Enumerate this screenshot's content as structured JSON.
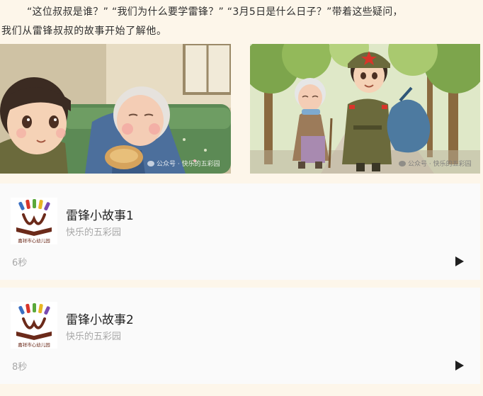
{
  "intro": {
    "line1": "“这位叔叔是谁？” “我们为什么要学雷锋？” “3月5日是什么日子？”带着这些疑问，",
    "line2": "我们从雷锋叔叔的故事开始了解他。"
  },
  "illustrations": {
    "left_watermark": "公众号 · 快乐的五彩园",
    "right_watermark": "公众号 · 快乐的五彩园"
  },
  "videos": [
    {
      "title": "雷锋小故事1",
      "channel": "快乐的五彩园",
      "duration": "6秒",
      "logo_caption": "嘉祥市心幼儿园",
      "logo_icon": "rainbow-kindergarten-logo",
      "play_icon": "play-triangle"
    },
    {
      "title": "雷锋小故事2",
      "channel": "快乐的五彩园",
      "duration": "8秒",
      "logo_caption": "嘉祥市心幼儿园",
      "logo_icon": "rainbow-kindergarten-logo",
      "play_icon": "play-triangle"
    }
  ],
  "colors": {
    "page_background": "#fdf6ea",
    "card_background": "#fafafa",
    "title_text": "#222222",
    "meta_text": "#a8a8a8",
    "logo_brown": "#6b2a1a",
    "soldier_green": "#6b6a3c",
    "star_red": "#d8352a"
  }
}
